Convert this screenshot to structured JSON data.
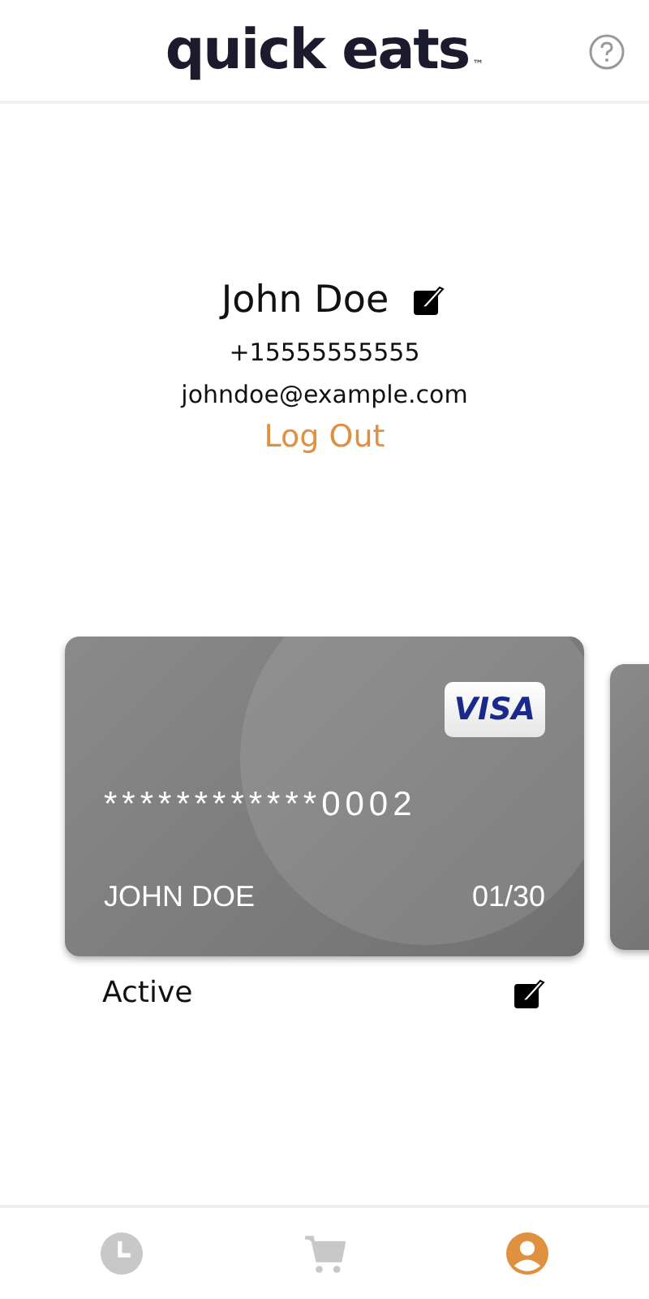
{
  "header": {
    "logo": "quick eats",
    "trademark": "™"
  },
  "profile": {
    "name": "John Doe",
    "phone": "+15555555555",
    "email": "johndoe@example.com",
    "logout": "Log Out"
  },
  "cards": [
    {
      "brand": "VISA",
      "number": "************0002",
      "holder": "JOHN DOE",
      "expiry": "01/30",
      "status": "Active"
    }
  ],
  "nav": [
    {
      "kind": "history",
      "selected": false
    },
    {
      "kind": "cart",
      "selected": false
    },
    {
      "kind": "profile",
      "selected": true
    }
  ]
}
